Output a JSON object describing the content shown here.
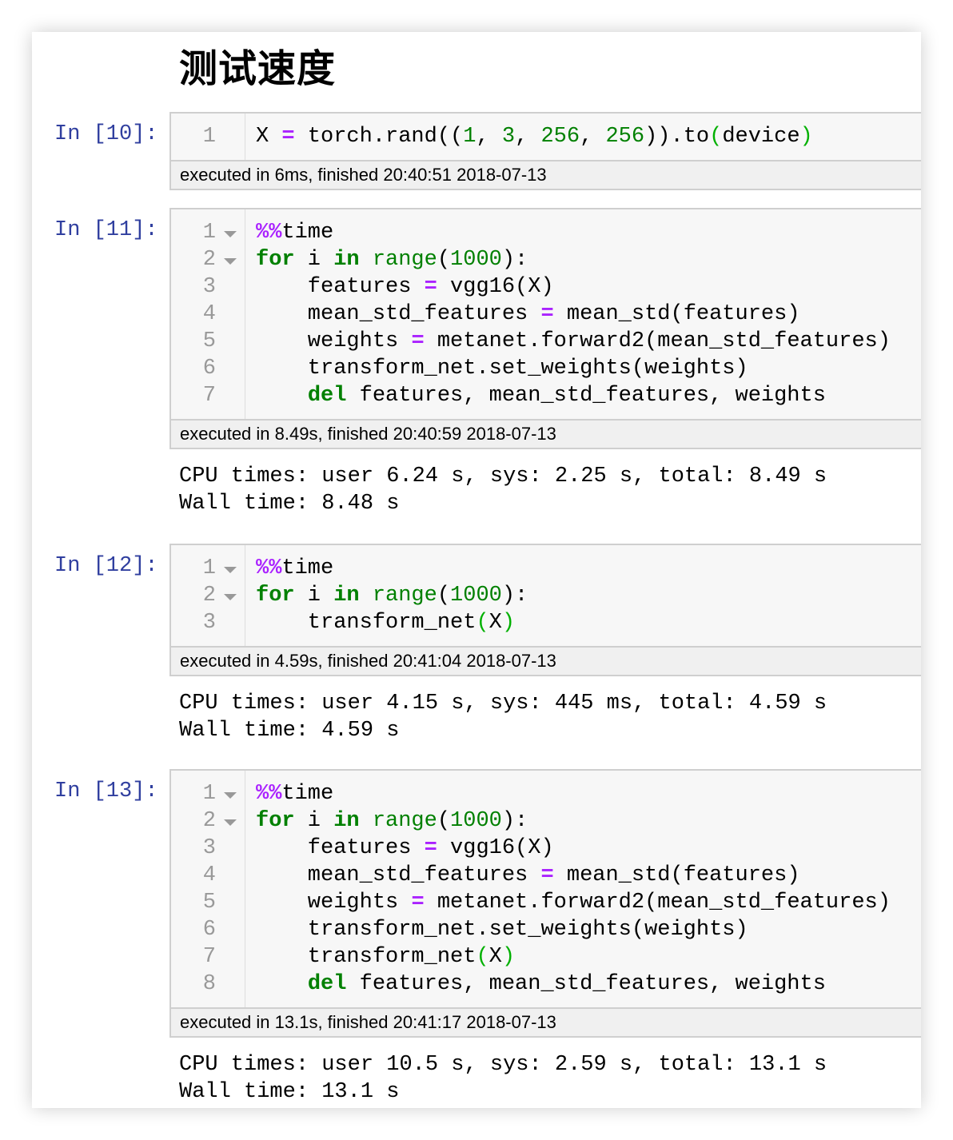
{
  "heading": "测试速度",
  "cells": [
    {
      "prompt": "In [10]:",
      "foldable": 0,
      "lines": [
        [
          [
            "X ",
            ""
          ],
          [
            "=",
            "op"
          ],
          [
            " torch.rand((",
            ""
          ],
          [
            "1",
            "num"
          ],
          [
            ", ",
            ""
          ],
          [
            "3",
            "num"
          ],
          [
            ", ",
            ""
          ],
          [
            "256",
            "num"
          ],
          [
            ", ",
            ""
          ],
          [
            "256",
            "num"
          ],
          [
            ")).to",
            ""
          ],
          [
            "(",
            "br"
          ],
          [
            "device",
            ""
          ],
          [
            ")",
            "br"
          ]
        ]
      ],
      "timing": "executed in 6ms, finished 20:40:51 2018-07-13",
      "output": []
    },
    {
      "prompt": "In [11]:",
      "foldable": 2,
      "lines": [
        [
          [
            "%%",
            "op"
          ],
          [
            "time",
            ""
          ]
        ],
        [
          [
            "for",
            "kw"
          ],
          [
            " i ",
            ""
          ],
          [
            "in",
            "kw"
          ],
          [
            " ",
            ""
          ],
          [
            "range",
            "bi"
          ],
          [
            "(",
            ""
          ],
          [
            "1000",
            "num"
          ],
          [
            "):",
            ""
          ]
        ],
        [
          [
            "    features ",
            ""
          ],
          [
            "=",
            "op"
          ],
          [
            " vgg16(X)",
            ""
          ]
        ],
        [
          [
            "    mean_std_features ",
            ""
          ],
          [
            "=",
            "op"
          ],
          [
            " mean_std(features)",
            ""
          ]
        ],
        [
          [
            "    weights ",
            ""
          ],
          [
            "=",
            "op"
          ],
          [
            " metanet.forward2(mean_std_features)",
            ""
          ]
        ],
        [
          [
            "    transform_net.set_weights(weights)",
            ""
          ]
        ],
        [
          [
            "    ",
            ""
          ],
          [
            "del",
            "kw"
          ],
          [
            " features, mean_std_features, weights",
            ""
          ]
        ]
      ],
      "timing": "executed in 8.49s, finished 20:40:59 2018-07-13",
      "output": [
        "CPU times: user 6.24 s, sys: 2.25 s, total: 8.49 s",
        "Wall time: 8.48 s"
      ]
    },
    {
      "prompt": "In [12]:",
      "foldable": 2,
      "lines": [
        [
          [
            "%%",
            "op"
          ],
          [
            "time",
            ""
          ]
        ],
        [
          [
            "for",
            "kw"
          ],
          [
            " i ",
            ""
          ],
          [
            "in",
            "kw"
          ],
          [
            " ",
            ""
          ],
          [
            "range",
            "bi"
          ],
          [
            "(",
            ""
          ],
          [
            "1000",
            "num"
          ],
          [
            "):",
            ""
          ]
        ],
        [
          [
            "    transform_net",
            ""
          ],
          [
            "(",
            "br"
          ],
          [
            "X",
            ""
          ],
          [
            ")",
            "br"
          ]
        ]
      ],
      "timing": "executed in 4.59s, finished 20:41:04 2018-07-13",
      "output": [
        "CPU times: user 4.15 s, sys: 445 ms, total: 4.59 s",
        "Wall time: 4.59 s"
      ]
    },
    {
      "prompt": "In [13]:",
      "foldable": 2,
      "lines": [
        [
          [
            "%%",
            "op"
          ],
          [
            "time",
            ""
          ]
        ],
        [
          [
            "for",
            "kw"
          ],
          [
            " i ",
            ""
          ],
          [
            "in",
            "kw"
          ],
          [
            " ",
            ""
          ],
          [
            "range",
            "bi"
          ],
          [
            "(",
            ""
          ],
          [
            "1000",
            "num"
          ],
          [
            "):",
            ""
          ]
        ],
        [
          [
            "    features ",
            ""
          ],
          [
            "=",
            "op"
          ],
          [
            " vgg16(X)",
            ""
          ]
        ],
        [
          [
            "    mean_std_features ",
            ""
          ],
          [
            "=",
            "op"
          ],
          [
            " mean_std(features)",
            ""
          ]
        ],
        [
          [
            "    weights ",
            ""
          ],
          [
            "=",
            "op"
          ],
          [
            " metanet.forward2(mean_std_features)",
            ""
          ]
        ],
        [
          [
            "    transform_net.set_weights(weights)",
            ""
          ]
        ],
        [
          [
            "    transform_net",
            ""
          ],
          [
            "(",
            "br"
          ],
          [
            "X",
            ""
          ],
          [
            ")",
            "br"
          ]
        ],
        [
          [
            "    ",
            ""
          ],
          [
            "del",
            "kw"
          ],
          [
            " features, mean_std_features, weights",
            ""
          ]
        ]
      ],
      "timing": "executed in 13.1s, finished 20:41:17 2018-07-13",
      "output": [
        "CPU times: user 10.5 s, sys: 2.59 s, total: 13.1 s",
        "Wall time: 13.1 s"
      ]
    }
  ]
}
